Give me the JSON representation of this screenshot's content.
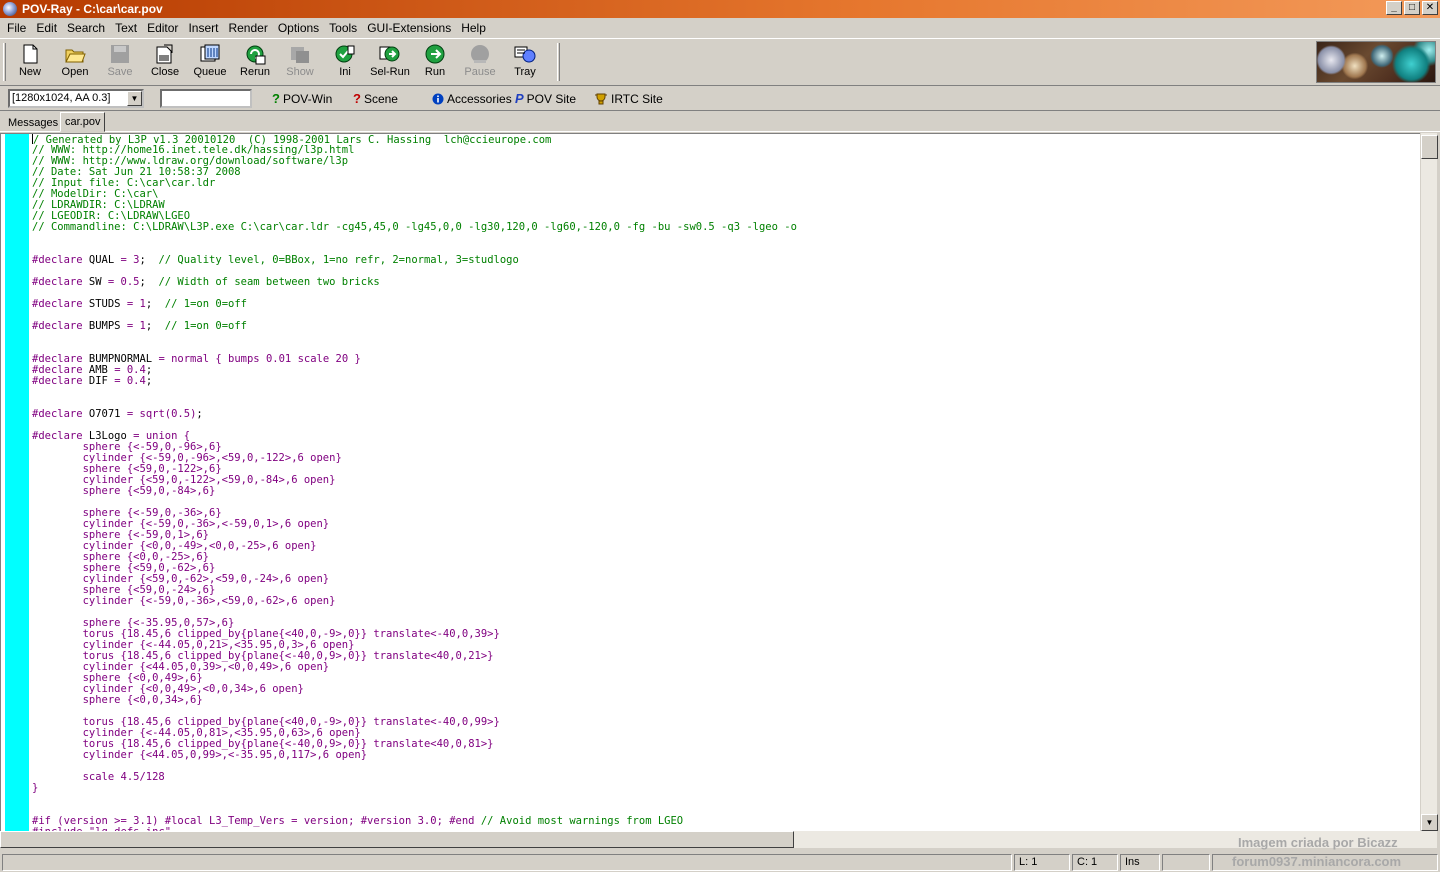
{
  "window": {
    "title": "POV-Ray - C:\\car\\car.pov"
  },
  "window_buttons": [
    "_",
    "□",
    "✕"
  ],
  "menu": [
    "File",
    "Edit",
    "Search",
    "Text",
    "Editor",
    "Insert",
    "Render",
    "Options",
    "Tools",
    "GUI-Extensions",
    "Help"
  ],
  "toolbar": [
    {
      "label": "New",
      "icon": "new-file-icon",
      "enabled": true
    },
    {
      "label": "Open",
      "icon": "open-folder-icon",
      "enabled": true
    },
    {
      "label": "Save",
      "icon": "save-icon",
      "enabled": false
    },
    {
      "label": "Close",
      "icon": "close-file-icon",
      "enabled": true
    },
    {
      "label": "Queue",
      "icon": "queue-icon",
      "enabled": true
    },
    {
      "label": "Rerun",
      "icon": "rerun-icon",
      "enabled": true
    },
    {
      "label": "Show",
      "icon": "show-icon",
      "enabled": false
    },
    {
      "label": "Ini",
      "icon": "ini-icon",
      "enabled": true
    },
    {
      "label": "Sel-Run",
      "icon": "sel-run-icon",
      "enabled": true
    },
    {
      "label": "Run",
      "icon": "run-icon",
      "enabled": true
    },
    {
      "label": "Pause",
      "icon": "pause-icon",
      "enabled": false
    },
    {
      "label": "Tray",
      "icon": "tray-icon",
      "enabled": true
    }
  ],
  "toolbar2": {
    "resolution": "[1280x1024, AA 0.3]",
    "command_value": "",
    "links": [
      "POV-Win",
      "Scene",
      "Accessories",
      "POV Site",
      "IRTC Site"
    ]
  },
  "tabs": [
    "Messages",
    "car.pov"
  ],
  "code_lines": [
    [
      [
        "c",
        "// Generated by L3P v1.3 20010120  (C) 1998-2001 Lars C. Hassing  lch@ccieurope.com"
      ]
    ],
    [
      [
        "c",
        "// WWW: http://home16.inet.tele.dk/hassing/l3p.html"
      ]
    ],
    [
      [
        "c",
        "// WWW: http://www.ldraw.org/download/software/l3p"
      ]
    ],
    [
      [
        "c",
        "// Date: Sat Jun 21 10:58:37 2008"
      ]
    ],
    [
      [
        "c",
        "// Input file: C:\\car\\car.ldr"
      ]
    ],
    [
      [
        "c",
        "// ModelDir: C:\\car\\"
      ]
    ],
    [
      [
        "c",
        "// LDRAWDIR: C:\\LDRAW"
      ]
    ],
    [
      [
        "c",
        "// LGEODIR: C:\\LDRAW\\LGEO"
      ]
    ],
    [
      [
        "c",
        "// Commandline: C:\\LDRAW\\L3P.exe C:\\car\\car.ldr -cg45,45,0 -lg45,0,0 -lg30,120,0 -lg60,-120,0 -fg -bu -sw0.5 -q3 -lgeo -o"
      ]
    ],
    [],
    [],
    [
      [
        "k",
        "#declare"
      ],
      [
        "t",
        " QUAL "
      ],
      [
        "k",
        "="
      ],
      [
        "t",
        " "
      ],
      [
        "n",
        "3"
      ],
      [
        "t",
        ";  "
      ],
      [
        "c",
        "// Quality level, 0=BBox, 1=no refr, 2=normal, 3=studlogo"
      ]
    ],
    [],
    [
      [
        "k",
        "#declare"
      ],
      [
        "t",
        " SW "
      ],
      [
        "k",
        "="
      ],
      [
        "t",
        " "
      ],
      [
        "n",
        "0.5"
      ],
      [
        "t",
        ";  "
      ],
      [
        "c",
        "// Width of seam between two bricks"
      ]
    ],
    [],
    [
      [
        "k",
        "#declare"
      ],
      [
        "t",
        " STUDS "
      ],
      [
        "k",
        "="
      ],
      [
        "t",
        " "
      ],
      [
        "n",
        "1"
      ],
      [
        "t",
        ";  "
      ],
      [
        "c",
        "// 1=on 0=off"
      ]
    ],
    [],
    [
      [
        "k",
        "#declare"
      ],
      [
        "t",
        " BUMPS "
      ],
      [
        "k",
        "="
      ],
      [
        "t",
        " "
      ],
      [
        "n",
        "1"
      ],
      [
        "t",
        ";  "
      ],
      [
        "c",
        "// 1=on 0=off"
      ]
    ],
    [],
    [],
    [
      [
        "k",
        "#declare"
      ],
      [
        "t",
        " BUMPNORMAL "
      ],
      [
        "k",
        "="
      ],
      [
        "t",
        " "
      ],
      [
        "k",
        "normal"
      ],
      [
        "t",
        " "
      ],
      [
        "k",
        "{"
      ],
      [
        "t",
        " "
      ],
      [
        "k",
        "bumps"
      ],
      [
        "t",
        " "
      ],
      [
        "n",
        "0.01"
      ],
      [
        "t",
        " "
      ],
      [
        "k",
        "scale"
      ],
      [
        "t",
        " "
      ],
      [
        "n",
        "20"
      ],
      [
        "t",
        " "
      ],
      [
        "k",
        "}"
      ]
    ],
    [
      [
        "k",
        "#declare"
      ],
      [
        "t",
        " AMB "
      ],
      [
        "k",
        "="
      ],
      [
        "t",
        " "
      ],
      [
        "n",
        "0.4"
      ],
      [
        "t",
        ";"
      ]
    ],
    [
      [
        "k",
        "#declare"
      ],
      [
        "t",
        " DIF "
      ],
      [
        "k",
        "="
      ],
      [
        "t",
        " "
      ],
      [
        "n",
        "0.4"
      ],
      [
        "t",
        ";"
      ]
    ],
    [],
    [],
    [
      [
        "k",
        "#declare"
      ],
      [
        "t",
        " O7071 "
      ],
      [
        "k",
        "="
      ],
      [
        "t",
        " "
      ],
      [
        "k",
        "sqrt("
      ],
      [
        "n",
        "0.5"
      ],
      [
        "k",
        ")"
      ],
      [
        "t",
        ";"
      ]
    ],
    [],
    [
      [
        "k",
        "#declare"
      ],
      [
        "t",
        " L3Logo "
      ],
      [
        "k",
        "="
      ],
      [
        "t",
        " "
      ],
      [
        "k",
        "union {"
      ]
    ],
    [
      [
        "t",
        "        "
      ],
      [
        "k",
        "sphere {<-59,0,-96>,6}"
      ]
    ],
    [
      [
        "t",
        "        "
      ],
      [
        "k",
        "cylinder {<-59,0,-96>,<59,0,-122>,6 open}"
      ]
    ],
    [
      [
        "t",
        "        "
      ],
      [
        "k",
        "sphere {<59,0,-122>,6}"
      ]
    ],
    [
      [
        "t",
        "        "
      ],
      [
        "k",
        "cylinder {<59,0,-122>,<59,0,-84>,6 open}"
      ]
    ],
    [
      [
        "t",
        "        "
      ],
      [
        "k",
        "sphere {<59,0,-84>,6}"
      ]
    ],
    [],
    [
      [
        "t",
        "        "
      ],
      [
        "k",
        "sphere {<-59,0,-36>,6}"
      ]
    ],
    [
      [
        "t",
        "        "
      ],
      [
        "k",
        "cylinder {<-59,0,-36>,<-59,0,1>,6 open}"
      ]
    ],
    [
      [
        "t",
        "        "
      ],
      [
        "k",
        "sphere {<-59,0,1>,6}"
      ]
    ],
    [
      [
        "t",
        "        "
      ],
      [
        "k",
        "cylinder {<0,0,-49>,<0,0,-25>,6 open}"
      ]
    ],
    [
      [
        "t",
        "        "
      ],
      [
        "k",
        "sphere {<0,0,-25>,6}"
      ]
    ],
    [
      [
        "t",
        "        "
      ],
      [
        "k",
        "sphere {<59,0,-62>,6}"
      ]
    ],
    [
      [
        "t",
        "        "
      ],
      [
        "k",
        "cylinder {<59,0,-62>,<59,0,-24>,6 open}"
      ]
    ],
    [
      [
        "t",
        "        "
      ],
      [
        "k",
        "sphere {<59,0,-24>,6}"
      ]
    ],
    [
      [
        "t",
        "        "
      ],
      [
        "k",
        "cylinder {<-59,0,-36>,<59,0,-62>,6 open}"
      ]
    ],
    [],
    [
      [
        "t",
        "        "
      ],
      [
        "k",
        "sphere {<-35.95,0,57>,6}"
      ]
    ],
    [
      [
        "t",
        "        "
      ],
      [
        "k",
        "torus {18.45,6 clipped_by{plane{<40,0,-9>,0}} translate<-40,0,39>}"
      ]
    ],
    [
      [
        "t",
        "        "
      ],
      [
        "k",
        "cylinder {<-44.05,0,21>,<35.95,0,3>,6 open}"
      ]
    ],
    [
      [
        "t",
        "        "
      ],
      [
        "k",
        "torus {18.45,6 clipped_by{plane{<-40,0,9>,0}} translate<40,0,21>}"
      ]
    ],
    [
      [
        "t",
        "        "
      ],
      [
        "k",
        "cylinder {<44.05,0,39>,<0,0,49>,6 open}"
      ]
    ],
    [
      [
        "t",
        "        "
      ],
      [
        "k",
        "sphere {<0,0,49>,6}"
      ]
    ],
    [
      [
        "t",
        "        "
      ],
      [
        "k",
        "cylinder {<0,0,49>,<0,0,34>,6 open}"
      ]
    ],
    [
      [
        "t",
        "        "
      ],
      [
        "k",
        "sphere {<0,0,34>,6}"
      ]
    ],
    [],
    [
      [
        "t",
        "        "
      ],
      [
        "k",
        "torus {18.45,6 clipped_by{plane{<40,0,-9>,0}} translate<-40,0,99>}"
      ]
    ],
    [
      [
        "t",
        "        "
      ],
      [
        "k",
        "cylinder {<-44.05,0,81>,<35.95,0,63>,6 open}"
      ]
    ],
    [
      [
        "t",
        "        "
      ],
      [
        "k",
        "torus {18.45,6 clipped_by{plane{<-40,0,9>,0}} translate<40,0,81>}"
      ]
    ],
    [
      [
        "t",
        "        "
      ],
      [
        "k",
        "cylinder {<44.05,0,99>,<-35.95,0,117>,6 open}"
      ]
    ],
    [],
    [
      [
        "t",
        "        "
      ],
      [
        "k",
        "scale 4.5/128"
      ]
    ],
    [
      [
        "k",
        "}"
      ]
    ],
    [],
    [],
    [
      [
        "k",
        "#if (version >= 3.1) #local L3_Temp_Vers = version; #version 3.0; #end "
      ],
      [
        "c",
        "// Avoid most warnings from LGEO"
      ]
    ],
    [
      [
        "k",
        "#include \"lg_defs.inc\""
      ]
    ]
  ],
  "status": {
    "line": "L: 1",
    "col": "C: 1",
    "mode": "Ins"
  },
  "watermark": {
    "line1": "Imagem criada por Bicazz",
    "line2": "forum0937.miniancora.com"
  }
}
